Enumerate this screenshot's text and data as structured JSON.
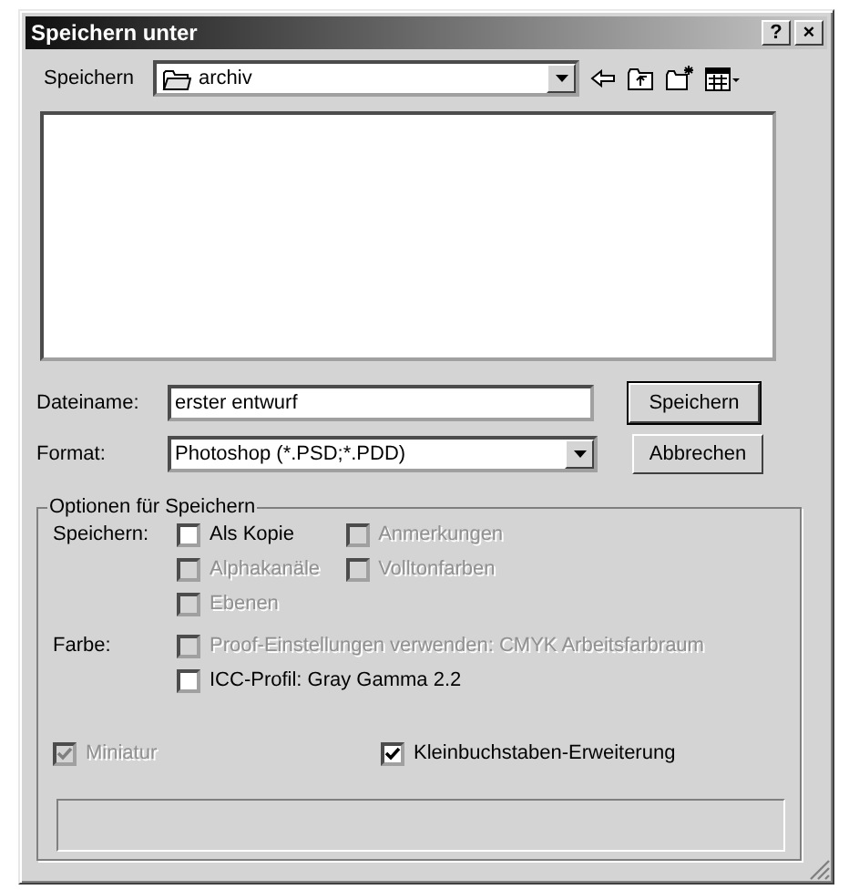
{
  "window": {
    "title": "Speichern unter",
    "controls": [
      "?",
      "×"
    ]
  },
  "save_in": {
    "label": "Speichern",
    "folder": "archiv"
  },
  "filename": {
    "label": "Dateiname:",
    "value": "erster entwurf"
  },
  "format": {
    "label": "Format:",
    "value": "Photoshop (*.PSD;*.PDD)"
  },
  "buttons": [
    {
      "label": "Speichern",
      "default": true
    },
    {
      "label": "Abbrechen",
      "default": false
    }
  ],
  "options": {
    "title": "Optionen für Speichern",
    "groups": [
      {
        "label": "Speichern:",
        "items": [
          {
            "label": "Als Kopie",
            "checked": false,
            "disabled": false
          },
          {
            "label": "Anmerkungen",
            "checked": false,
            "disabled": true
          },
          {
            "label": "Alphakanäle",
            "checked": false,
            "disabled": true
          },
          {
            "label": "Volltonfarben",
            "checked": false,
            "disabled": true
          },
          {
            "label": "Ebenen",
            "checked": false,
            "disabled": true
          }
        ]
      },
      {
        "label": "Farbe:",
        "items": [
          {
            "label": "Proof-Einstellungen verwenden: CMYK Arbeitsfarbraum",
            "checked": false,
            "disabled": true
          },
          {
            "label": "ICC-Profil: Gray Gamma 2.2",
            "checked": false,
            "disabled": false
          }
        ]
      }
    ],
    "bottom": [
      {
        "label": "Miniatur",
        "checked": true,
        "disabled": true
      },
      {
        "label": "Kleinbuchstaben-Erweiterung",
        "checked": true,
        "disabled": false
      }
    ]
  }
}
